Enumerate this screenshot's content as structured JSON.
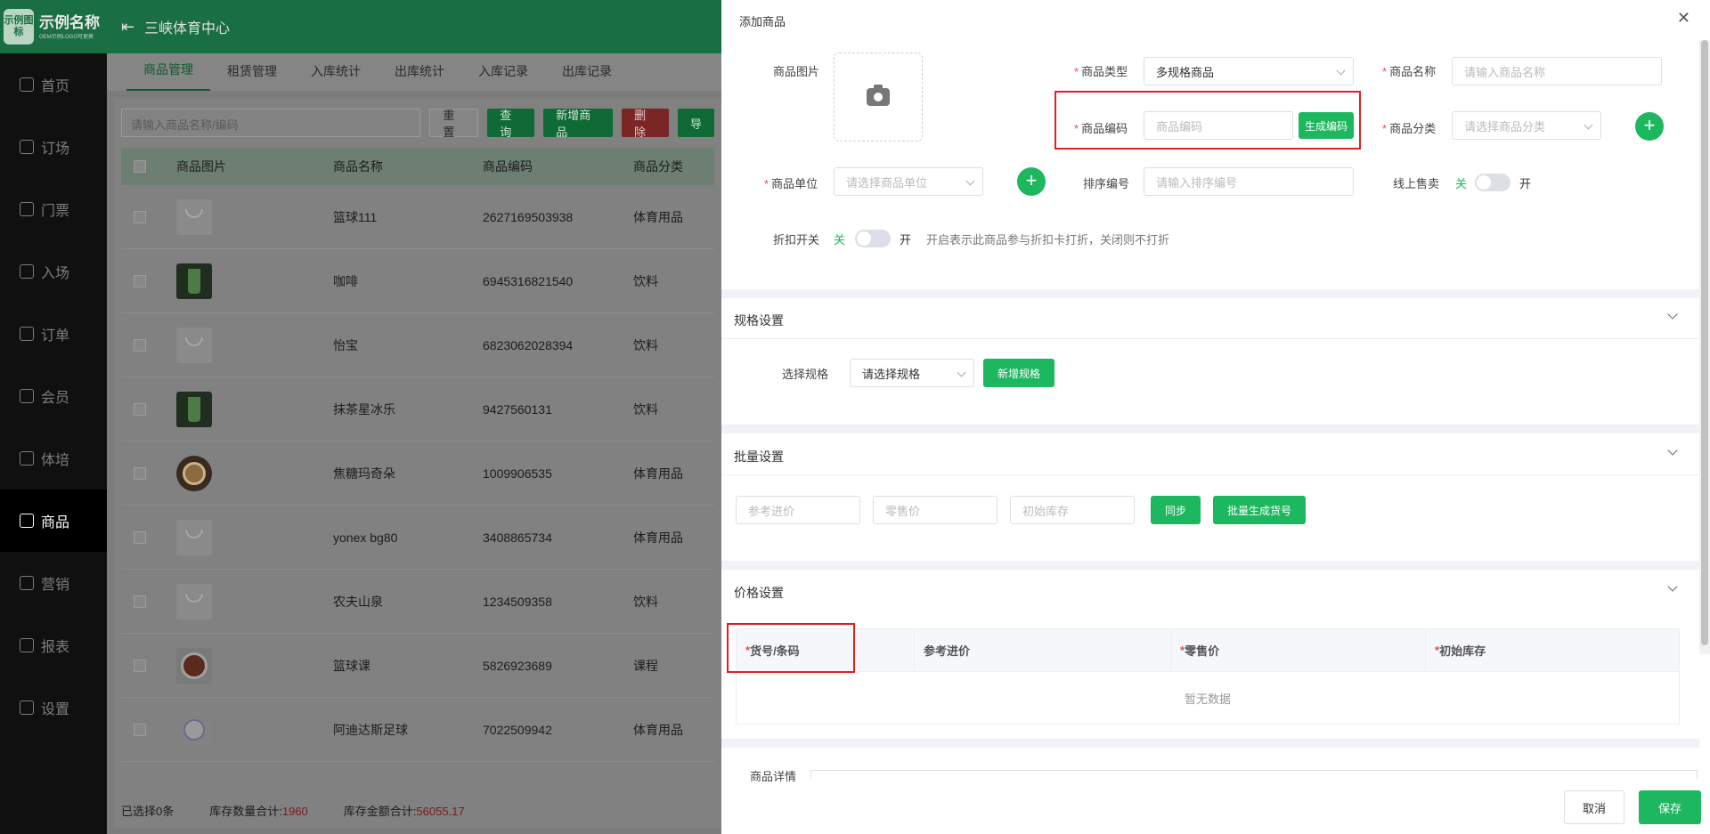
{
  "app": {
    "logo_badge": "示例图标",
    "logo_name": "示例名称",
    "logo_sub": "OEM示例LOGO可更换",
    "venue": "三峡体育中心"
  },
  "sidebar": {
    "items": [
      {
        "label": "首页",
        "icon": "home-icon"
      },
      {
        "label": "订场",
        "icon": "court-icon"
      },
      {
        "label": "门票",
        "icon": "ticket-icon"
      },
      {
        "label": "入场",
        "icon": "entry-icon"
      },
      {
        "label": "订单",
        "icon": "order-icon"
      },
      {
        "label": "会员",
        "icon": "member-icon"
      },
      {
        "label": "体培",
        "icon": "training-icon"
      },
      {
        "label": "商品",
        "icon": "goods-icon"
      },
      {
        "label": "营销",
        "icon": "marketing-icon"
      },
      {
        "label": "报表",
        "icon": "report-icon"
      },
      {
        "label": "设置",
        "icon": "settings-icon"
      }
    ],
    "active_index": 7
  },
  "tabs": [
    "商品管理",
    "租赁管理",
    "入库统计",
    "出库统计",
    "入库记录",
    "出库记录"
  ],
  "toolbar": {
    "search_placeholder": "请输入商品名称/编码",
    "reset": "重置",
    "query": "查询",
    "add": "新增商品",
    "delete": "删除",
    "more": "导"
  },
  "table": {
    "headers": [
      "商品图片",
      "商品名称",
      "商品编码",
      "商品分类"
    ],
    "rows": [
      {
        "image": "bag",
        "name": "篮球111",
        "code": "2627169503938",
        "category": "体育用品"
      },
      {
        "image": "cup",
        "name": "咖啡",
        "code": "6945316821540",
        "category": "饮料"
      },
      {
        "image": "bag",
        "name": "怡宝",
        "code": "6823062028394",
        "category": "饮料"
      },
      {
        "image": "cup",
        "name": "抹茶星冰乐",
        "code": "9427560131",
        "category": "饮料"
      },
      {
        "image": "coffee",
        "name": "焦糖玛奇朵",
        "code": "1009906535",
        "category": "体育用品"
      },
      {
        "image": "bag",
        "name": "yonex bg80",
        "code": "3408865734",
        "category": "体育用品"
      },
      {
        "image": "bag",
        "name": "农夫山泉",
        "code": "1234509358",
        "category": "饮料"
      },
      {
        "image": "ball",
        "name": "篮球课",
        "code": "5826923689",
        "category": "课程"
      },
      {
        "image": "foot",
        "name": "阿迪达斯足球",
        "code": "7022509942",
        "category": "体育用品"
      }
    ]
  },
  "footer": {
    "selected": "已选择0条",
    "stock_qty_label": "库存数量合计:",
    "stock_qty": "1960",
    "stock_amount_label": "库存金额合计:",
    "stock_amount": "56055.17"
  },
  "panel": {
    "title": "添加商品",
    "image_label": "商品图片",
    "type_label": "商品类型",
    "type_value": "多规格商品",
    "name_label": "商品名称",
    "name_placeholder": "请输入商品名称",
    "code_label": "商品编码",
    "code_placeholder": "商品编码",
    "gen_code": "生成编码",
    "category_label": "商品分类",
    "category_placeholder": "请选择商品分类",
    "unit_label": "商品单位",
    "unit_placeholder": "请选择商品单位",
    "sort_label": "排序编号",
    "sort_placeholder": "请输入排序编号",
    "online_label": "线上售卖",
    "off": "关",
    "on": "开",
    "discount_label": "折扣开关",
    "discount_hint": "开启表示此商品参与折扣卡打折，关闭则不打折",
    "spec_section": "规格设置",
    "spec_label": "选择规格",
    "spec_placeholder": "请选择规格",
    "add_spec": "新增规格",
    "batch_section": "批量设置",
    "ref_price_ph": "参考进价",
    "retail_ph": "零售价",
    "init_stock_ph": "初始库存",
    "sync": "同步",
    "batch_gen": "批量生成货号",
    "price_section": "价格设置",
    "price_headers": [
      "货号/条码",
      "参考进价",
      "零售价",
      "初始库存"
    ],
    "empty": "暂无数据",
    "detail_label": "商品详情",
    "cancel": "取消",
    "save": "保存"
  }
}
